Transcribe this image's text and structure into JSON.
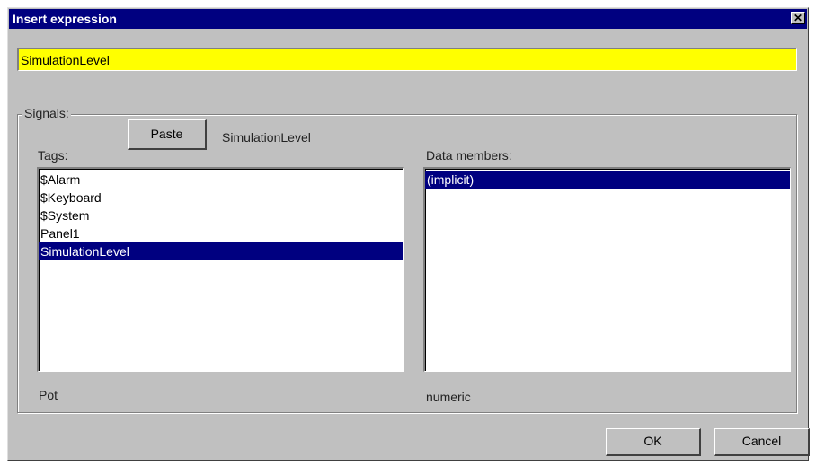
{
  "window": {
    "title": "Insert expression"
  },
  "expression": {
    "value": "SimulationLevel"
  },
  "signals": {
    "group_label": "Signals:",
    "paste_label": "Paste",
    "paste_preview": "SimulationLevel",
    "tags_label": "Tags:",
    "data_members_label": "Data members:",
    "tags": [
      {
        "label": "$Alarm",
        "selected": false
      },
      {
        "label": "$Keyboard",
        "selected": false
      },
      {
        "label": "$System",
        "selected": false
      },
      {
        "label": "Panel1",
        "selected": false
      },
      {
        "label": "SimulationLevel",
        "selected": true
      }
    ],
    "data_members": [
      {
        "label": "(implicit)",
        "selected": true
      }
    ],
    "tag_type": "Pot",
    "member_type": "numeric"
  },
  "buttons": {
    "ok_label": "OK",
    "cancel_label": "Cancel"
  },
  "colors": {
    "title_bar": "#000080",
    "selection": "#000080",
    "expression_bg": "#ffff00",
    "dialog_bg": "#c0c0c0"
  }
}
